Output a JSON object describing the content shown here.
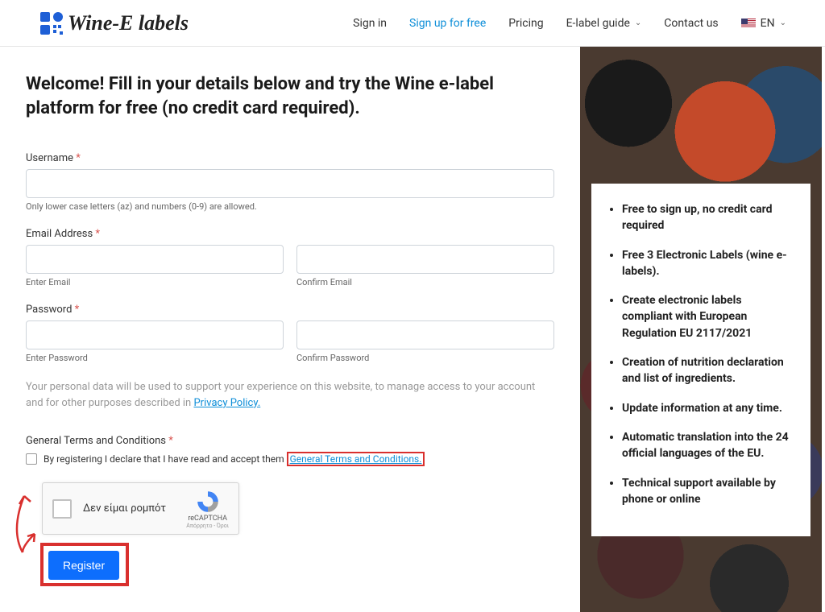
{
  "header": {
    "logo_text": "Wine-E labels",
    "nav": {
      "sign_in": "Sign in",
      "sign_up": "Sign up for free",
      "pricing": "Pricing",
      "elabel_guide": "E-label guide",
      "contact": "Contact us",
      "lang": "EN"
    }
  },
  "form": {
    "heading": "Welcome! Fill in your details below and try the Wine e-label platform for free (no credit card required).",
    "username_label": "Username",
    "username_hint": "Only lower case letters (az) and numbers (0-9) are allowed.",
    "email_label": "Email Address",
    "email_enter": "Enter Email",
    "email_confirm": "Confirm Email",
    "password_label": "Password",
    "password_enter": "Enter Password",
    "password_confirm": "Confirm Password",
    "privacy_text_before": "Your personal data will be used to support your experience on this website, to manage access to your account and for other purposes described in ",
    "privacy_link": "Privacy Policy.",
    "terms_label": "General Terms and Conditions",
    "terms_check_text": "By registering I declare that I have read and accept them ",
    "terms_link": "General Terms and Conditions.",
    "recaptcha_label": "Δεν είμαι ρομπότ",
    "recaptcha_brand": "reCAPTCHA",
    "recaptcha_terms": "Απόρρητο - Όροι",
    "register_btn": "Register"
  },
  "benefits": [
    "Free to sign up, no credit card required",
    "Free 3 Electronic Labels (wine e-labels).",
    "Create electronic labels compliant with European Regulation EU 2117/2021",
    "Creation of nutrition declaration and list of ingredients.",
    "Update information at any time.",
    "Automatic translation into the 24 official languages of the EU.",
    "Technical support available by phone or online"
  ]
}
